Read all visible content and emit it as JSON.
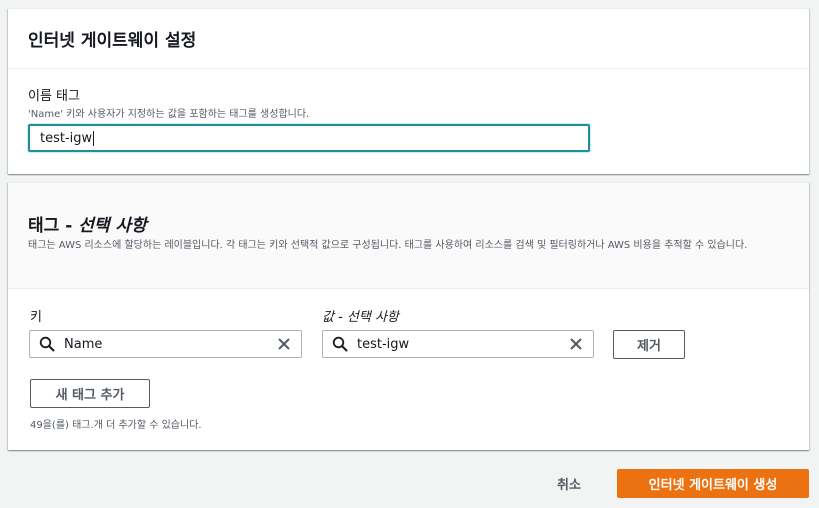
{
  "settings": {
    "title": "인터넷 게이트웨이 설정",
    "name_tag": {
      "label": "이름 태그",
      "description": "'Name' 키와 사용자가 지정하는 값을 포함하는 태그를 생성합니다.",
      "value": "test-igw"
    }
  },
  "tags": {
    "title_main": "태그 - ",
    "title_optional": "선택 사항",
    "description": "태그는 AWS 리소스에 할당하는 레이블입니다. 각 태그는 키와 선택적 값으로 구성됩니다. 태그를 사용하여 리소스를 검색 및 필터링하거나 AWS 비용을 추적할 수 있습니다.",
    "key_label": "키",
    "value_label": "값 - 선택 사항",
    "rows": [
      {
        "key": "Name",
        "value": "test-igw"
      }
    ],
    "remove_label": "제거",
    "add_label": "새 태그 추가",
    "remaining_text": "49을(를) 태그.개 더 추가할 수 있습니다."
  },
  "footer": {
    "cancel_label": "취소",
    "create_label": "인터넷 게이트웨이 생성"
  },
  "colors": {
    "primary": "#ec7211",
    "focus": "#1f8e9f"
  },
  "icons": [
    "search-icon",
    "clear-icon"
  ]
}
